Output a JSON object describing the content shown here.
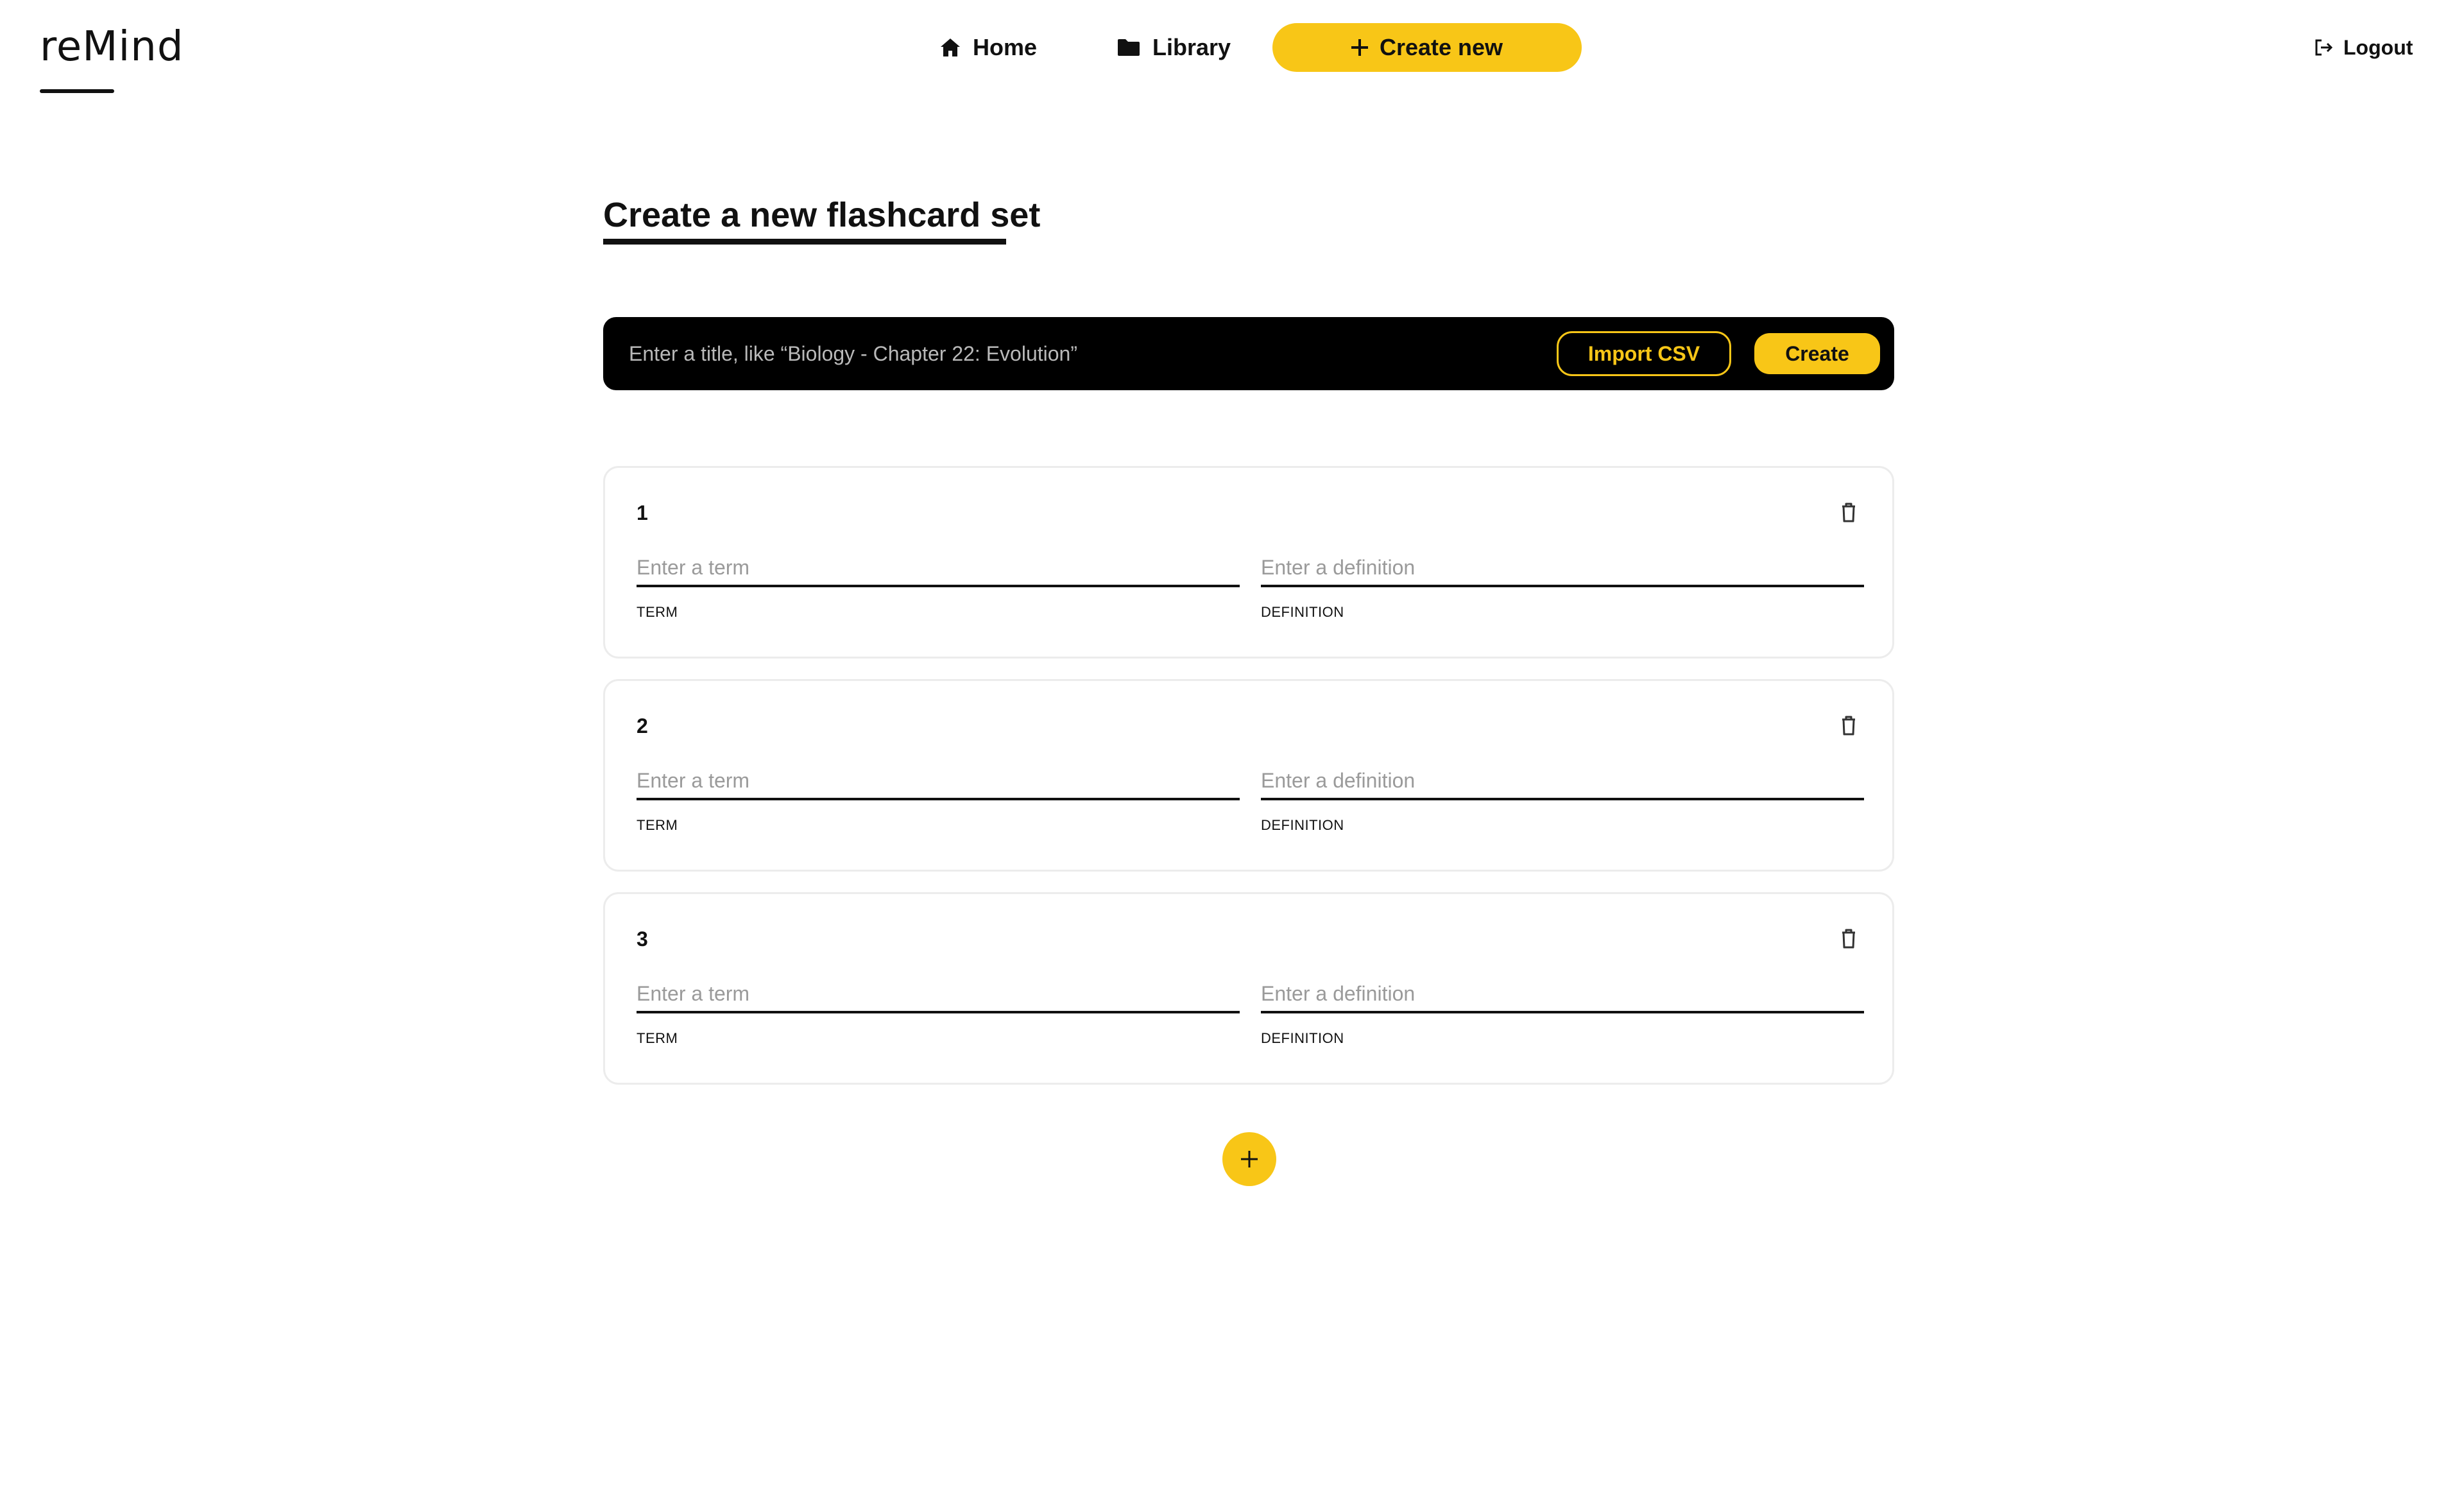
{
  "app": {
    "logo_text": "reMind"
  },
  "nav": {
    "home_label": "Home",
    "library_label": "Library",
    "create_new_label": "Create new",
    "logout_label": "Logout",
    "icons": {
      "home": "home-icon",
      "library": "folder-icon",
      "create": "plus-icon",
      "logout": "logout-icon"
    }
  },
  "page": {
    "title": "Create a new flashcard set"
  },
  "title_bar": {
    "title_placeholder": "Enter a title, like “Biology - Chapter 22: Evolution”",
    "import_label": "Import CSV",
    "create_label": "Create"
  },
  "cards": [
    {
      "number": "1",
      "term_placeholder": "Enter a term",
      "term_label": "TERM",
      "definition_placeholder": "Enter a definition",
      "definition_label": "DEFINITION"
    },
    {
      "number": "2",
      "term_placeholder": "Enter a term",
      "term_label": "TERM",
      "definition_placeholder": "Enter a definition",
      "definition_label": "DEFINITION"
    },
    {
      "number": "3",
      "term_placeholder": "Enter a term",
      "term_label": "TERM",
      "definition_placeholder": "Enter a definition",
      "definition_label": "DEFINITION"
    }
  ],
  "add_card": {
    "icon": "plus-icon"
  },
  "colors": {
    "accent": "#f8c617",
    "dark": "#000000",
    "text": "#111111",
    "placeholder": "#9a9a9a",
    "card_border": "#ececec"
  }
}
